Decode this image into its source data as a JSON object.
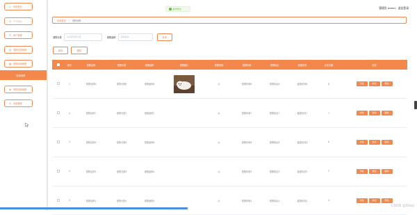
{
  "sidebar": {
    "items": [
      {
        "label": "系统首页",
        "icon": "home-icon"
      },
      {
        "label": "个人中心",
        "icon": "user-icon"
      },
      {
        "label": "用户管理",
        "icon": "users-icon"
      },
      {
        "label": "宠物分类管理",
        "icon": "category-icon"
      },
      {
        "label": "宠物商城管理",
        "icon": "shop-icon"
      },
      {
        "label": "宠物领养管理",
        "icon": "adopt-icon"
      },
      {
        "label": "系统管理",
        "icon": "settings-icon"
      }
    ],
    "active_subitem": "宠物领养"
  },
  "toast": {
    "text": "操作成功"
  },
  "header": {
    "user_text": "管理员 admin",
    "logout": "退出登录"
  },
  "breadcrumb": {
    "home": "系统首页",
    "current": "宠物领养"
  },
  "filter": {
    "category_label": "宠物分类",
    "category_placeholder": "请选择宠物分类",
    "breed_label": "宠物品种",
    "breed_placeholder": "宠物品种",
    "search_button": "查询"
  },
  "actions": {
    "add": "新增",
    "delete": "删除"
  },
  "table": {
    "columns": [
      "",
      "索引",
      "宠物名称",
      "宠物分类",
      "宠物品种",
      "宠物图片",
      "宠物性别",
      "宠物年龄",
      "宠物特点",
      "健康情况",
      "点击次数",
      "操作"
    ],
    "rows": [
      {
        "index": "1",
        "name": "宠物名称8",
        "category": "宠物分类8",
        "breed": "宠物品种8",
        "has_image": true,
        "gender": "公",
        "age": "宠物年龄8",
        "feature": "宠物特点8",
        "health": "健康情况8",
        "clicks": "8"
      },
      {
        "index": "2",
        "name": "宠物名称7",
        "category": "宠物分类7",
        "breed": "宠物品种7",
        "has_image": false,
        "gender": "公",
        "age": "宠物年龄7",
        "feature": "宠物特点7",
        "health": "健康情况7",
        "clicks": "7"
      },
      {
        "index": "3",
        "name": "宠物名称6",
        "category": "宠物分类6",
        "breed": "宠物品种6",
        "has_image": false,
        "gender": "公",
        "age": "宠物年龄6",
        "feature": "宠物特点6",
        "health": "健康情况6",
        "clicks": "6"
      },
      {
        "index": "4",
        "name": "宠物名称5",
        "category": "宠物分类5",
        "breed": "宠物品种5",
        "has_image": false,
        "gender": "公",
        "age": "宠物年龄5",
        "feature": "宠物特点5",
        "health": "健康情况5",
        "clicks": "5"
      },
      {
        "index": "5",
        "name": "宠物名称4",
        "category": "宠物分类4",
        "breed": "宠物品种4",
        "has_image": false,
        "gender": "公",
        "age": "宠物年龄4",
        "feature": "宠物特点4",
        "health": "健康情况4",
        "clicks": "4"
      }
    ],
    "row_buttons": {
      "detail": "详情",
      "edit": "修改",
      "delete": "删除"
    }
  },
  "watermark": "CSDN @Sheji"
}
